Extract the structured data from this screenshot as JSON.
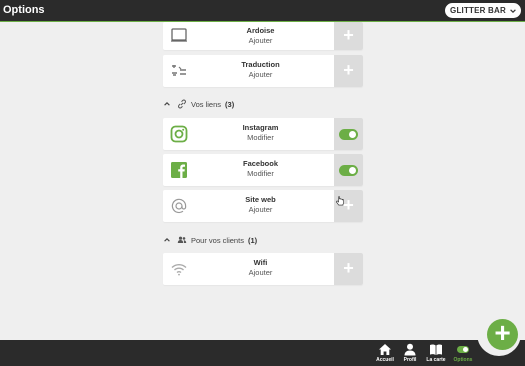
{
  "header": {
    "title": "Options",
    "venue": "GLITTER BAR"
  },
  "cards_top": [
    {
      "title": "Ardoise",
      "action": "Ajouter"
    },
    {
      "title": "Traduction",
      "action": "Ajouter"
    }
  ],
  "sections": [
    {
      "label": "Vos liens",
      "count": "(3)",
      "items": [
        {
          "title": "Instagram",
          "action": "Modifier",
          "enabled": true
        },
        {
          "title": "Facebook",
          "action": "Modifier",
          "enabled": true
        },
        {
          "title": "Site web",
          "action": "Ajouter",
          "enabled": false
        }
      ]
    },
    {
      "label": "Pour vos clients",
      "count": "(1)",
      "items": [
        {
          "title": "Wifi",
          "action": "Ajouter",
          "enabled": false
        }
      ]
    }
  ],
  "nav": [
    {
      "label": "Accueil",
      "icon": "home-icon"
    },
    {
      "label": "Profil",
      "icon": "user-icon"
    },
    {
      "label": "La carte",
      "icon": "book-icon"
    },
    {
      "label": "Options",
      "icon": "toggle-icon",
      "active": true
    }
  ],
  "colors": {
    "accent": "#6cae46",
    "bar": "#2b2b2b",
    "background": "#efefef"
  }
}
